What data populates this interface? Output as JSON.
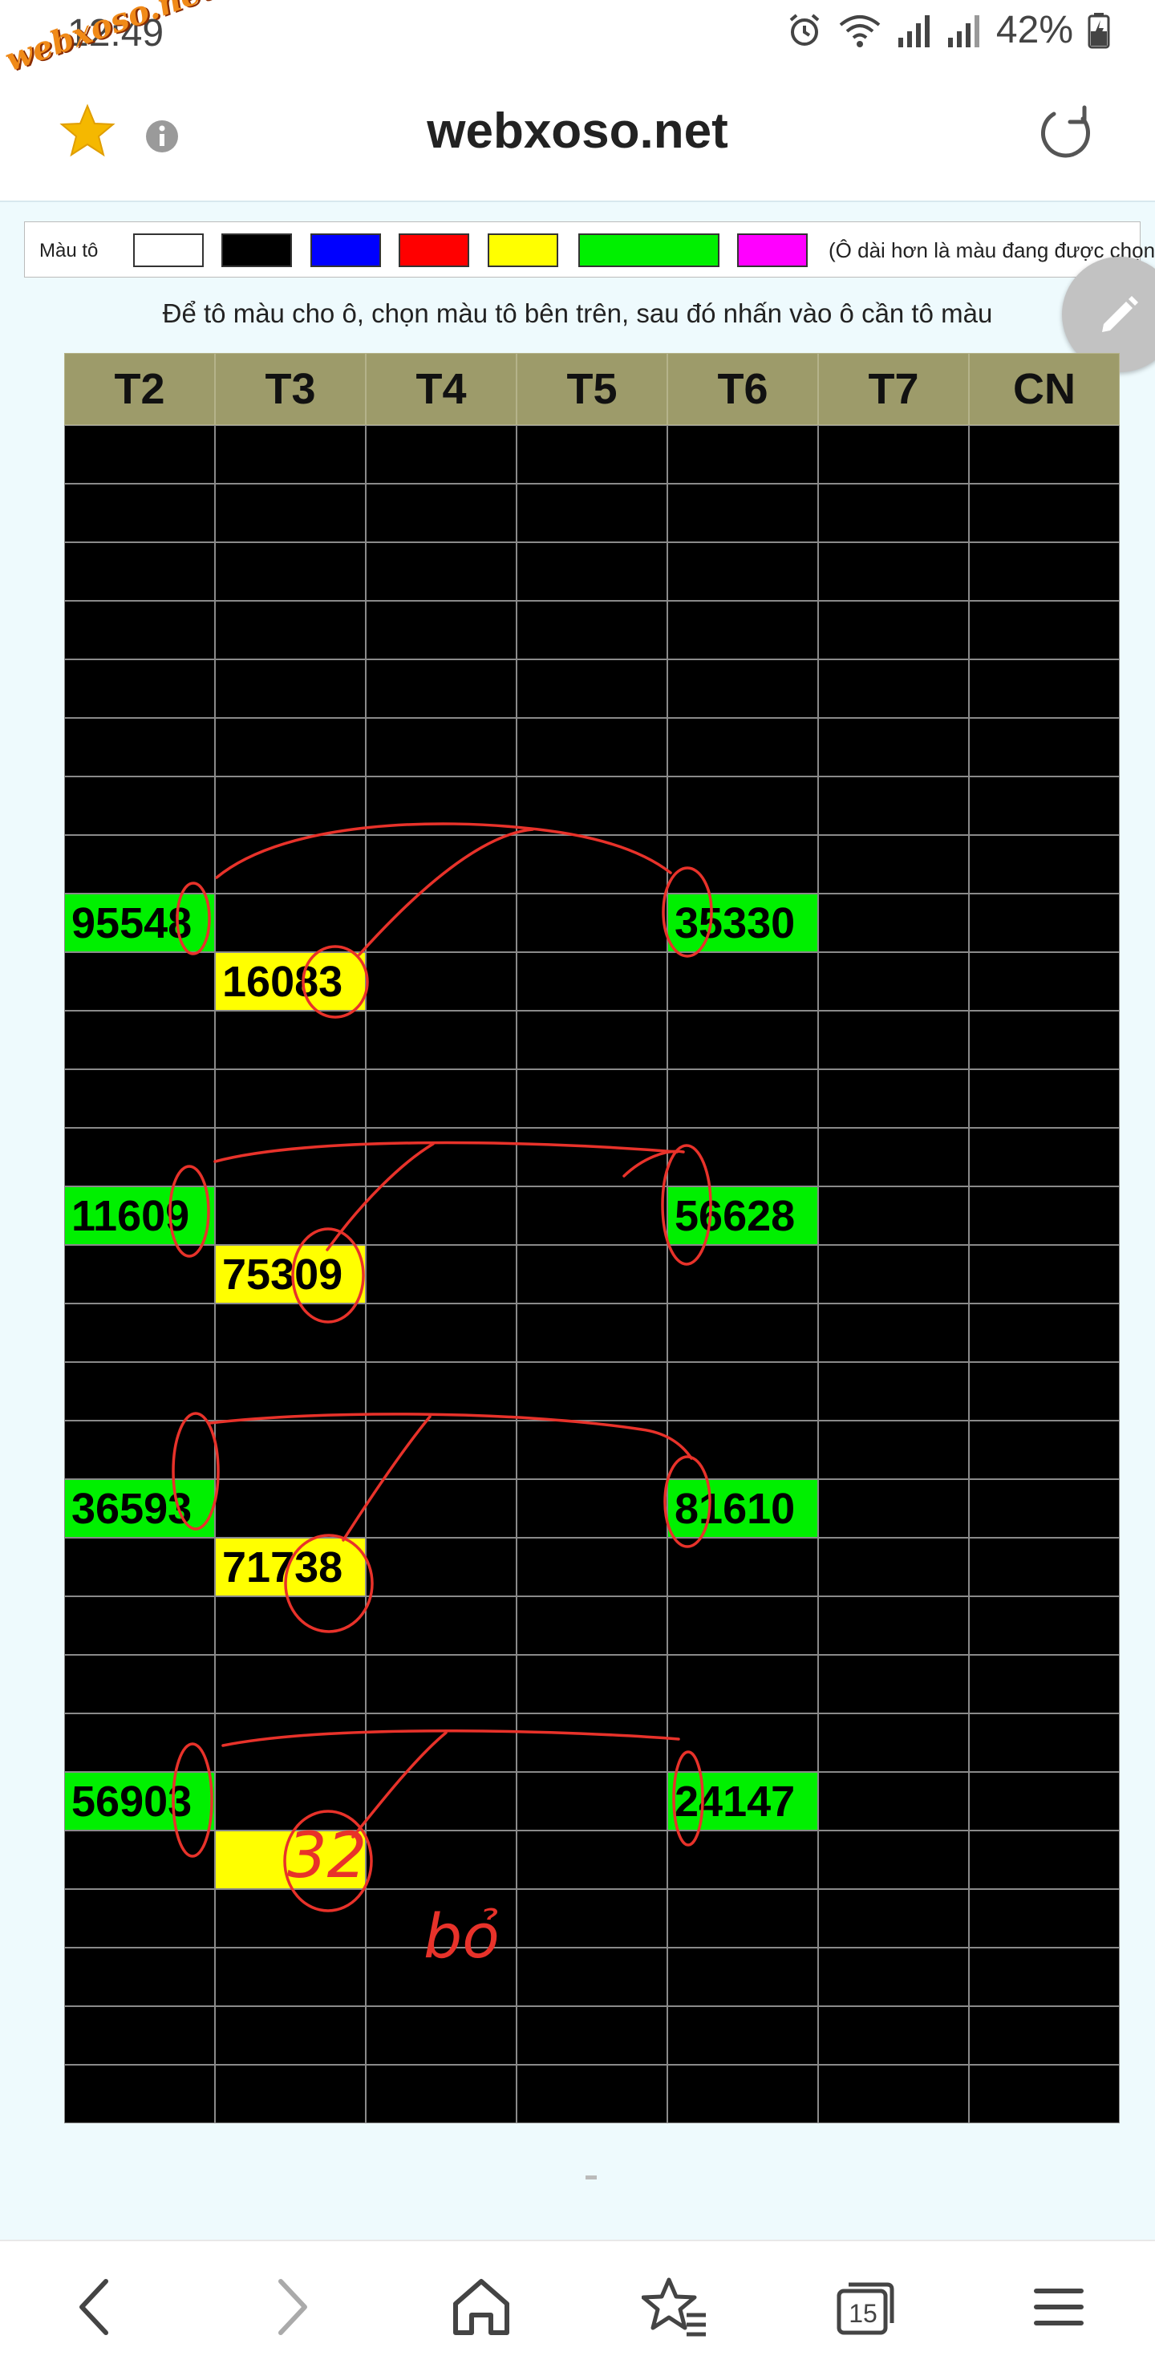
{
  "status": {
    "time": "12:49",
    "battery": "42%"
  },
  "watermark": "webxoso.net",
  "toolbar": {
    "title": "webxoso.net"
  },
  "palette": {
    "label": "Màu tô",
    "colors": [
      "#ffffff",
      "#000000",
      "#0000ff",
      "#ff0000",
      "#ffff00",
      "#00ff00",
      "#ff00ff"
    ],
    "note": "(Ô dài hơn là màu đang được chọn)"
  },
  "instruction": "Để tô màu cho ô, chọn màu tô bên trên, sau đó nhấn vào ô cần tô màu",
  "grid": {
    "headers": [
      "T2",
      "T3",
      "T4",
      "T5",
      "T6",
      "T7",
      "CN"
    ],
    "rows": [
      [
        {
          "t": "",
          "c": ""
        },
        {
          "t": "",
          "c": ""
        },
        {
          "t": "",
          "c": ""
        },
        {
          "t": "",
          "c": ""
        },
        {
          "t": "",
          "c": ""
        },
        {
          "t": "",
          "c": ""
        },
        {
          "t": "",
          "c": ""
        }
      ],
      [
        {
          "t": "",
          "c": ""
        },
        {
          "t": "",
          "c": ""
        },
        {
          "t": "",
          "c": ""
        },
        {
          "t": "",
          "c": ""
        },
        {
          "t": "",
          "c": ""
        },
        {
          "t": "",
          "c": ""
        },
        {
          "t": "",
          "c": ""
        }
      ],
      [
        {
          "t": "",
          "c": ""
        },
        {
          "t": "",
          "c": ""
        },
        {
          "t": "",
          "c": ""
        },
        {
          "t": "",
          "c": ""
        },
        {
          "t": "",
          "c": ""
        },
        {
          "t": "",
          "c": ""
        },
        {
          "t": "",
          "c": ""
        }
      ],
      [
        {
          "t": "",
          "c": ""
        },
        {
          "t": "",
          "c": ""
        },
        {
          "t": "",
          "c": ""
        },
        {
          "t": "",
          "c": ""
        },
        {
          "t": "",
          "c": ""
        },
        {
          "t": "",
          "c": ""
        },
        {
          "t": "",
          "c": ""
        }
      ],
      [
        {
          "t": "",
          "c": ""
        },
        {
          "t": "",
          "c": ""
        },
        {
          "t": "",
          "c": ""
        },
        {
          "t": "",
          "c": ""
        },
        {
          "t": "",
          "c": ""
        },
        {
          "t": "",
          "c": ""
        },
        {
          "t": "",
          "c": ""
        }
      ],
      [
        {
          "t": "",
          "c": ""
        },
        {
          "t": "",
          "c": ""
        },
        {
          "t": "",
          "c": ""
        },
        {
          "t": "",
          "c": ""
        },
        {
          "t": "",
          "c": ""
        },
        {
          "t": "",
          "c": ""
        },
        {
          "t": "",
          "c": ""
        }
      ],
      [
        {
          "t": "",
          "c": ""
        },
        {
          "t": "",
          "c": ""
        },
        {
          "t": "",
          "c": ""
        },
        {
          "t": "",
          "c": ""
        },
        {
          "t": "",
          "c": ""
        },
        {
          "t": "",
          "c": ""
        },
        {
          "t": "",
          "c": ""
        }
      ],
      [
        {
          "t": "",
          "c": ""
        },
        {
          "t": "",
          "c": ""
        },
        {
          "t": "",
          "c": ""
        },
        {
          "t": "",
          "c": ""
        },
        {
          "t": "",
          "c": ""
        },
        {
          "t": "",
          "c": ""
        },
        {
          "t": "",
          "c": ""
        }
      ],
      [
        {
          "t": "95548",
          "c": "green"
        },
        {
          "t": "",
          "c": ""
        },
        {
          "t": "",
          "c": ""
        },
        {
          "t": "",
          "c": ""
        },
        {
          "t": "35330",
          "c": "green"
        },
        {
          "t": "",
          "c": ""
        },
        {
          "t": "",
          "c": ""
        }
      ],
      [
        {
          "t": "",
          "c": ""
        },
        {
          "t": "16083",
          "c": "yellow"
        },
        {
          "t": "",
          "c": ""
        },
        {
          "t": "",
          "c": ""
        },
        {
          "t": "",
          "c": ""
        },
        {
          "t": "",
          "c": ""
        },
        {
          "t": "",
          "c": ""
        }
      ],
      [
        {
          "t": "",
          "c": ""
        },
        {
          "t": "",
          "c": ""
        },
        {
          "t": "",
          "c": ""
        },
        {
          "t": "",
          "c": ""
        },
        {
          "t": "",
          "c": ""
        },
        {
          "t": "",
          "c": ""
        },
        {
          "t": "",
          "c": ""
        }
      ],
      [
        {
          "t": "",
          "c": ""
        },
        {
          "t": "",
          "c": ""
        },
        {
          "t": "",
          "c": ""
        },
        {
          "t": "",
          "c": ""
        },
        {
          "t": "",
          "c": ""
        },
        {
          "t": "",
          "c": ""
        },
        {
          "t": "",
          "c": ""
        }
      ],
      [
        {
          "t": "",
          "c": ""
        },
        {
          "t": "",
          "c": ""
        },
        {
          "t": "",
          "c": ""
        },
        {
          "t": "",
          "c": ""
        },
        {
          "t": "",
          "c": ""
        },
        {
          "t": "",
          "c": ""
        },
        {
          "t": "",
          "c": ""
        }
      ],
      [
        {
          "t": "11609",
          "c": "green"
        },
        {
          "t": "",
          "c": ""
        },
        {
          "t": "",
          "c": ""
        },
        {
          "t": "",
          "c": ""
        },
        {
          "t": "56628",
          "c": "green"
        },
        {
          "t": "",
          "c": ""
        },
        {
          "t": "",
          "c": ""
        }
      ],
      [
        {
          "t": "",
          "c": ""
        },
        {
          "t": "75309",
          "c": "yellow"
        },
        {
          "t": "",
          "c": ""
        },
        {
          "t": "",
          "c": ""
        },
        {
          "t": "",
          "c": ""
        },
        {
          "t": "",
          "c": ""
        },
        {
          "t": "",
          "c": ""
        }
      ],
      [
        {
          "t": "",
          "c": ""
        },
        {
          "t": "",
          "c": ""
        },
        {
          "t": "",
          "c": ""
        },
        {
          "t": "",
          "c": ""
        },
        {
          "t": "",
          "c": ""
        },
        {
          "t": "",
          "c": ""
        },
        {
          "t": "",
          "c": ""
        }
      ],
      [
        {
          "t": "",
          "c": ""
        },
        {
          "t": "",
          "c": ""
        },
        {
          "t": "",
          "c": ""
        },
        {
          "t": "",
          "c": ""
        },
        {
          "t": "",
          "c": ""
        },
        {
          "t": "",
          "c": ""
        },
        {
          "t": "",
          "c": ""
        }
      ],
      [
        {
          "t": "",
          "c": ""
        },
        {
          "t": "",
          "c": ""
        },
        {
          "t": "",
          "c": ""
        },
        {
          "t": "",
          "c": ""
        },
        {
          "t": "",
          "c": ""
        },
        {
          "t": "",
          "c": ""
        },
        {
          "t": "",
          "c": ""
        }
      ],
      [
        {
          "t": "36593",
          "c": "green"
        },
        {
          "t": "",
          "c": ""
        },
        {
          "t": "",
          "c": ""
        },
        {
          "t": "",
          "c": ""
        },
        {
          "t": "81610",
          "c": "green"
        },
        {
          "t": "",
          "c": ""
        },
        {
          "t": "",
          "c": ""
        }
      ],
      [
        {
          "t": "",
          "c": ""
        },
        {
          "t": "71738",
          "c": "yellow"
        },
        {
          "t": "",
          "c": ""
        },
        {
          "t": "",
          "c": ""
        },
        {
          "t": "",
          "c": ""
        },
        {
          "t": "",
          "c": ""
        },
        {
          "t": "",
          "c": ""
        }
      ],
      [
        {
          "t": "",
          "c": ""
        },
        {
          "t": "",
          "c": ""
        },
        {
          "t": "",
          "c": ""
        },
        {
          "t": "",
          "c": ""
        },
        {
          "t": "",
          "c": ""
        },
        {
          "t": "",
          "c": ""
        },
        {
          "t": "",
          "c": ""
        }
      ],
      [
        {
          "t": "",
          "c": ""
        },
        {
          "t": "",
          "c": ""
        },
        {
          "t": "",
          "c": ""
        },
        {
          "t": "",
          "c": ""
        },
        {
          "t": "",
          "c": ""
        },
        {
          "t": "",
          "c": ""
        },
        {
          "t": "",
          "c": ""
        }
      ],
      [
        {
          "t": "",
          "c": ""
        },
        {
          "t": "",
          "c": ""
        },
        {
          "t": "",
          "c": ""
        },
        {
          "t": "",
          "c": ""
        },
        {
          "t": "",
          "c": ""
        },
        {
          "t": "",
          "c": ""
        },
        {
          "t": "",
          "c": ""
        }
      ],
      [
        {
          "t": "56903",
          "c": "green"
        },
        {
          "t": "",
          "c": ""
        },
        {
          "t": "",
          "c": ""
        },
        {
          "t": "",
          "c": ""
        },
        {
          "t": "24147",
          "c": "green"
        },
        {
          "t": "",
          "c": ""
        },
        {
          "t": "",
          "c": ""
        }
      ],
      [
        {
          "t": "",
          "c": ""
        },
        {
          "t": "",
          "c": "yellow"
        },
        {
          "t": "",
          "c": ""
        },
        {
          "t": "",
          "c": ""
        },
        {
          "t": "",
          "c": ""
        },
        {
          "t": "",
          "c": ""
        },
        {
          "t": "",
          "c": ""
        }
      ],
      [
        {
          "t": "",
          "c": ""
        },
        {
          "t": "",
          "c": ""
        },
        {
          "t": "",
          "c": ""
        },
        {
          "t": "",
          "c": ""
        },
        {
          "t": "",
          "c": ""
        },
        {
          "t": "",
          "c": ""
        },
        {
          "t": "",
          "c": ""
        }
      ],
      [
        {
          "t": "",
          "c": ""
        },
        {
          "t": "",
          "c": ""
        },
        {
          "t": "",
          "c": ""
        },
        {
          "t": "",
          "c": ""
        },
        {
          "t": "",
          "c": ""
        },
        {
          "t": "",
          "c": ""
        },
        {
          "t": "",
          "c": ""
        }
      ],
      [
        {
          "t": "",
          "c": ""
        },
        {
          "t": "",
          "c": ""
        },
        {
          "t": "",
          "c": ""
        },
        {
          "t": "",
          "c": ""
        },
        {
          "t": "",
          "c": ""
        },
        {
          "t": "",
          "c": ""
        },
        {
          "t": "",
          "c": ""
        }
      ],
      [
        {
          "t": "",
          "c": ""
        },
        {
          "t": "",
          "c": ""
        },
        {
          "t": "",
          "c": ""
        },
        {
          "t": "",
          "c": ""
        },
        {
          "t": "",
          "c": ""
        },
        {
          "t": "",
          "c": ""
        },
        {
          "t": "",
          "c": ""
        }
      ]
    ]
  },
  "annotations": {
    "handwritten": [
      "32",
      "bỏ"
    ],
    "color": "#e8322a"
  },
  "bottom_nav": {
    "tabs_count": "15",
    "icons": [
      "back-icon",
      "forward-icon",
      "home-icon",
      "bookmarks-icon",
      "tabs-icon",
      "menu-icon"
    ]
  }
}
